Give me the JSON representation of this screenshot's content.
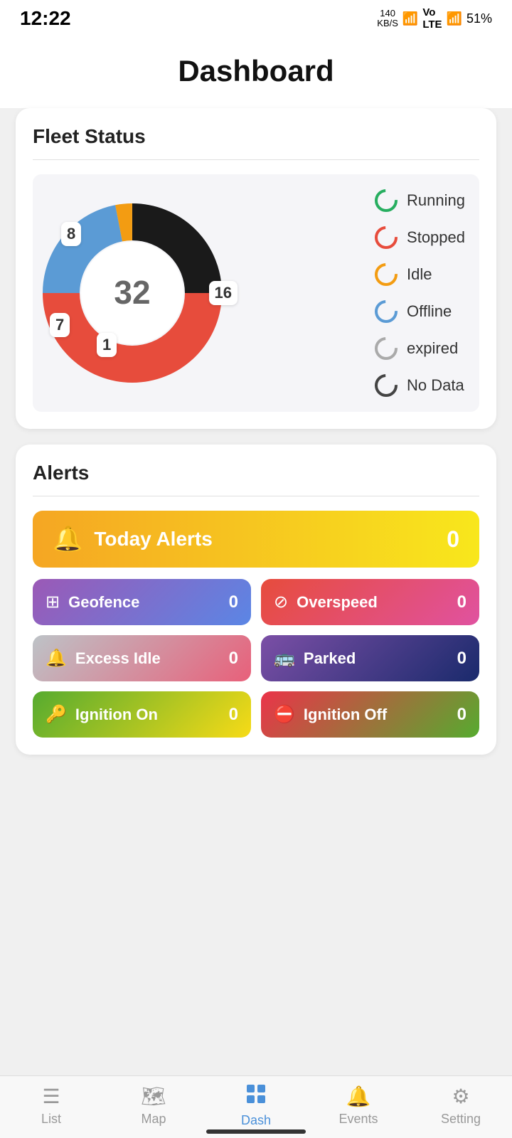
{
  "statusBar": {
    "time": "12:22",
    "data": "140\nKB/S",
    "battery": "51%"
  },
  "header": {
    "title": "Dashboard"
  },
  "fleetStatus": {
    "title": "Fleet Status",
    "totalVehicles": "32",
    "segments": [
      {
        "label": "8",
        "position": "top-left",
        "color": "#1a1a1a"
      },
      {
        "label": "16",
        "position": "right",
        "color": "#e74c3c"
      },
      {
        "label": "7",
        "position": "bottom-left",
        "color": "#5b9bd5"
      },
      {
        "label": "1",
        "position": "bottom-center",
        "color": "#f39c12"
      }
    ],
    "legend": [
      {
        "name": "running-legend-icon",
        "label": "Running",
        "color": "#27ae60"
      },
      {
        "name": "stopped-legend-icon",
        "label": "Stopped",
        "color": "#e74c3c"
      },
      {
        "name": "idle-legend-icon",
        "label": "Idle",
        "color": "#f39c12"
      },
      {
        "name": "offline-legend-icon",
        "label": "Offline",
        "color": "#5b9bd5"
      },
      {
        "name": "expired-legend-icon",
        "label": "expired",
        "color": "#aaa"
      },
      {
        "name": "nodata-legend-icon",
        "label": "No Data",
        "color": "#444"
      }
    ]
  },
  "alerts": {
    "title": "Alerts",
    "todayAlerts": {
      "label": "Today Alerts",
      "count": "0"
    },
    "items": [
      {
        "id": "geofence",
        "icon": "⊞",
        "label": "Geofence",
        "count": "0",
        "style": "geofence-btn"
      },
      {
        "id": "overspeed",
        "icon": "⊘",
        "label": "Overspeed",
        "count": "0",
        "style": "overspeed-btn"
      },
      {
        "id": "excess-idle",
        "icon": "🔔",
        "label": "Excess Idle",
        "count": "0",
        "style": "excess-idle-btn"
      },
      {
        "id": "parked",
        "icon": "🚌",
        "label": "Parked",
        "count": "0",
        "style": "parked-btn"
      },
      {
        "id": "ignition-on",
        "icon": "🔑",
        "label": "Ignition On",
        "count": "0",
        "style": "ignition-on-btn"
      },
      {
        "id": "ignition-off",
        "icon": "⛔",
        "label": "Ignition Off",
        "count": "0",
        "style": "ignition-off-btn"
      }
    ]
  },
  "bottomNav": {
    "items": [
      {
        "id": "list",
        "icon": "☰",
        "label": "List",
        "active": false
      },
      {
        "id": "map",
        "icon": "🗺",
        "label": "Map",
        "active": false
      },
      {
        "id": "dash",
        "icon": "⊞",
        "label": "Dash",
        "active": true
      },
      {
        "id": "events",
        "icon": "🔔",
        "label": "Events",
        "active": false
      },
      {
        "id": "setting",
        "icon": "⚙",
        "label": "Setting",
        "active": false
      }
    ]
  }
}
